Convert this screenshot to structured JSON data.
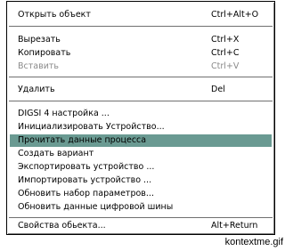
{
  "menu": {
    "items": [
      {
        "label": "Открыть объект",
        "shortcut": "Ctrl+Alt+O"
      },
      {
        "label": "Вырезать",
        "shortcut": "Ctrl+X"
      },
      {
        "label": "Копировать",
        "shortcut": "Ctrl+C"
      },
      {
        "label": "Вставить",
        "shortcut": "Ctrl+V"
      },
      {
        "label": "Удалить",
        "shortcut": "Del"
      },
      {
        "label": "DIGSI 4 настройка ..."
      },
      {
        "label": "Инициализировать Устройство..."
      },
      {
        "label": "Прочитать данные процесса"
      },
      {
        "label": "Создать вариант"
      },
      {
        "label": "Экспортировать устройство ..."
      },
      {
        "label": "Импортировать устройство ..."
      },
      {
        "label": "Обновить набор параметров..."
      },
      {
        "label": "Обновить данные цифровой шины"
      },
      {
        "label": "Свойства обьекта...",
        "shortcut": "Alt+Return"
      }
    ],
    "highlight_color": "#6a9a92"
  },
  "caption": "kontextme.gif"
}
